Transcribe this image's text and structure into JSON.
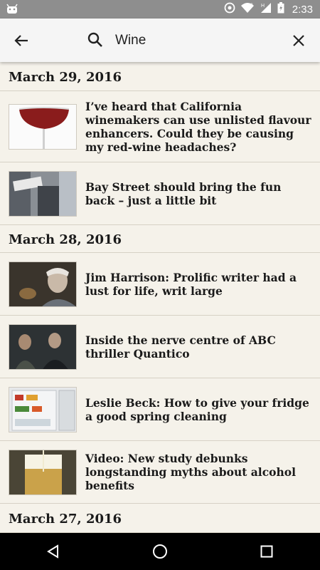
{
  "status_bar": {
    "time": "2:33",
    "icons": [
      "android-notification-icon",
      "sync-icon",
      "wifi-icon",
      "signal-icon",
      "battery-icon"
    ]
  },
  "search": {
    "query": "Wine",
    "icons": {
      "back": "arrow-back-icon",
      "search": "search-icon",
      "clear": "close-icon"
    }
  },
  "results": {
    "groups": [
      {
        "date": "March 29, 2016",
        "articles": [
          {
            "headline": "I’ve heard that California winemakers can use unlisted flavour enhancers. Could they be causing my red-wine headaches?",
            "thumbnail": "red-wine-glass"
          },
          {
            "headline": "Bay Street should bring the fun back – just a little bit",
            "thumbnail": "bay-street-sign"
          }
        ]
      },
      {
        "date": "March 28, 2016",
        "articles": [
          {
            "headline": "Jim Harrison: Prolific writer had a lust for life, writ large",
            "thumbnail": "jim-harrison-portrait"
          },
          {
            "headline": "Inside the nerve centre of ABC thriller Quantico",
            "thumbnail": "quantico-still"
          },
          {
            "headline": "Leslie Beck: How to give your fridge a good spring cleaning",
            "thumbnail": "open-fridge"
          },
          {
            "headline": "Video: New study debunks longstanding myths about alcohol benefits",
            "thumbnail": "beer-glass"
          }
        ]
      },
      {
        "date": "March 27, 2016",
        "articles": []
      }
    ]
  },
  "nav_bar": {
    "icons": [
      "back-triangle-icon",
      "home-circle-icon",
      "recents-square-icon"
    ]
  },
  "colors": {
    "background": "#f5f2ea",
    "status_bar": "#8e8e8e",
    "divider": "#d6d1c5",
    "text": "#1a1a1a"
  }
}
